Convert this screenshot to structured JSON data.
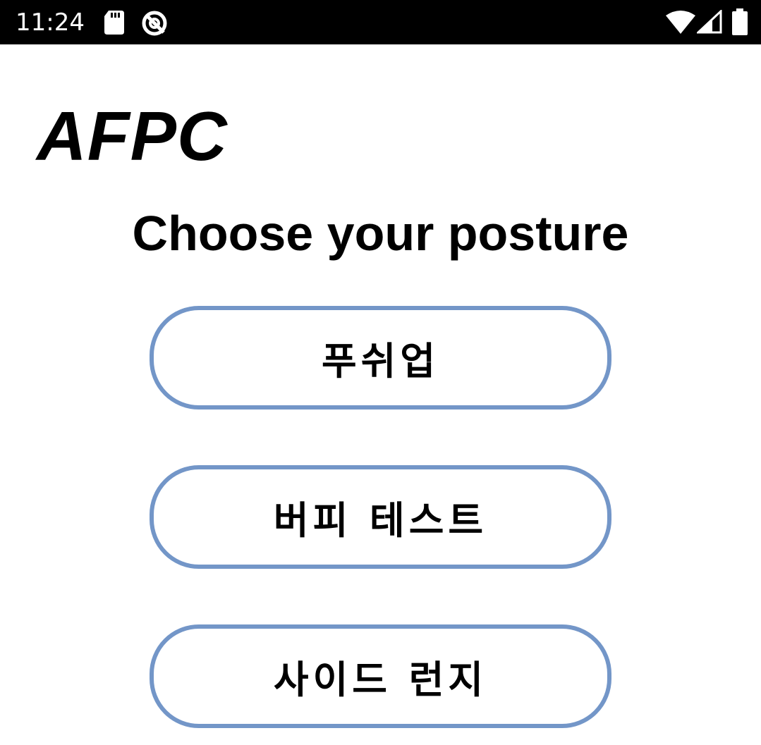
{
  "status_bar": {
    "time": "11:24",
    "icons": [
      "sd-card-icon",
      "vpn-icon",
      "wifi-icon",
      "signal-icon",
      "battery-icon"
    ],
    "background": "#000000"
  },
  "app": {
    "title": "AFPC",
    "heading": "Choose your posture"
  },
  "postures": [
    {
      "label": "푸쉬업"
    },
    {
      "label": "버피 테스트"
    },
    {
      "label": "사이드 런지"
    }
  ],
  "colors": {
    "button_border": "#7396c8",
    "text": "#000000",
    "background": "#ffffff"
  }
}
